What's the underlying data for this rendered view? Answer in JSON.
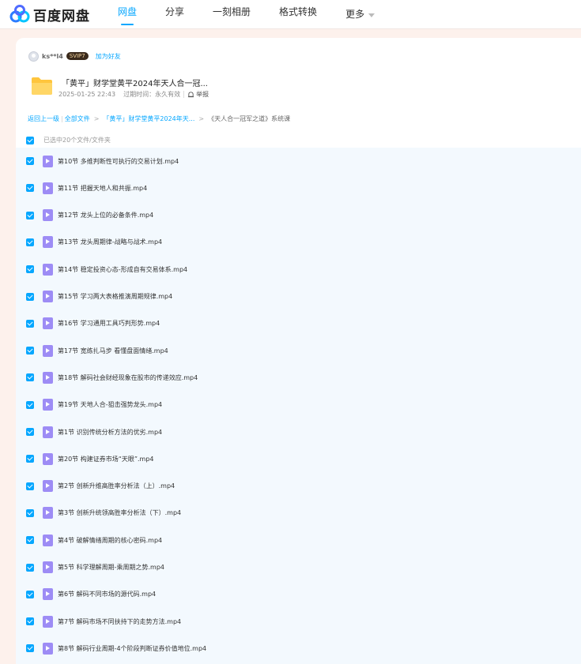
{
  "brand": {
    "name": "百度网盘"
  },
  "nav": {
    "items": [
      {
        "label": "网盘",
        "active": true
      },
      {
        "label": "分享",
        "active": false
      },
      {
        "label": "一刻相册",
        "active": false
      },
      {
        "label": "格式转换",
        "active": false
      }
    ],
    "more_label": "更多"
  },
  "sharer": {
    "username": "ks**l4",
    "vip_badge": "SVIP7",
    "add_friend": "加为好友"
  },
  "share": {
    "title": "「黄平」财学堂黄平2024年天人合一冠...",
    "date": "2025-01-25 22:43",
    "expiry": "过期时间：永久有效",
    "report": "举报"
  },
  "breadcrumb": {
    "back": "返回上一级",
    "all_files": "全部文件",
    "parent": "「黄平」财学堂黄平2024年天...",
    "current": "《天人合一冠军之道》系统课"
  },
  "selection": {
    "label": "已选中20个文件/文件夹"
  },
  "files": [
    {
      "name": "第10节 多维判断性可执行的交易计划.mp4",
      "checked": true
    },
    {
      "name": "第11节 把握天地人和共振.mp4",
      "checked": true
    },
    {
      "name": "第12节 龙头上位的必备条件.mp4",
      "checked": true
    },
    {
      "name": "第13节 龙头周期律-战略与战术.mp4",
      "checked": true
    },
    {
      "name": "第14节 稳定投资心态-形成自有交易体系.mp4",
      "checked": true
    },
    {
      "name": "第15节 学习两大表格推演周期规律.mp4",
      "checked": true
    },
    {
      "name": "第16节 学习通用工具巧判形势.mp4",
      "checked": true
    },
    {
      "name": "第17节 宽练扎马步 看懂盘面情绪.mp4",
      "checked": true
    },
    {
      "name": "第18节 解码社会财经现象在股市的传递效应.mp4",
      "checked": true
    },
    {
      "name": "第19节 天地人合-狙击强势龙头.mp4",
      "checked": true
    },
    {
      "name": "第1节 识别传统分析方法的优劣.mp4",
      "checked": true
    },
    {
      "name": "第20节 构建证券市场“天眼”.mp4",
      "checked": true
    },
    {
      "name": "第2节 创新升维高胜率分析法（上）.mp4",
      "checked": true
    },
    {
      "name": "第3节 创新升统领高胜率分析法（下）.mp4",
      "checked": true
    },
    {
      "name": "第4节 破解情绪周期的核心密码.mp4",
      "checked": true
    },
    {
      "name": "第5节 科学理解周期-乘周期之势.mp4",
      "checked": true
    },
    {
      "name": "第6节 解码不同市场的源代码.mp4",
      "checked": true
    },
    {
      "name": "第7节 解码市场不同扶持下的走势方法.mp4",
      "checked": true
    },
    {
      "name": "第8节 解码行业周期-4个阶段判断证券价值地位.mp4",
      "checked": true
    }
  ],
  "colors": {
    "accent": "#06a7ff",
    "video_icon": "#9d8cf5",
    "page_bg": "#fdf1ec",
    "list_bg": "#f3f9fe"
  }
}
